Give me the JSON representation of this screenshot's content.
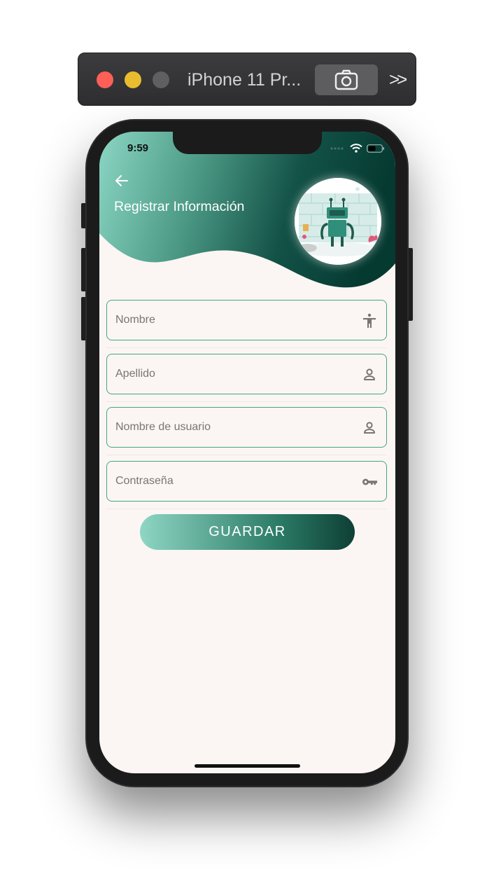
{
  "simulator": {
    "title": "iPhone 11 Pr...",
    "screenshot_icon": "camera-icon",
    "overflow_icon": "chevron-double-right-icon"
  },
  "status_bar": {
    "time": "9:59"
  },
  "header": {
    "back_icon": "arrow-left-icon",
    "title": "Registrar Información",
    "avatar": "robot-illustration"
  },
  "form": {
    "fields": [
      {
        "placeholder": "Nombre",
        "icon": "accessibility-icon"
      },
      {
        "placeholder": "Apellido",
        "icon": "person-icon"
      },
      {
        "placeholder": "Nombre de usuario",
        "icon": "person-icon"
      },
      {
        "placeholder": "Contraseña",
        "icon": "key-icon"
      }
    ],
    "submit_label": "GUARDAR"
  },
  "colors": {
    "accent": "#44a585",
    "gradient_start": "#8fd6c4",
    "gradient_end": "#063a31",
    "background": "#fbf6f3"
  }
}
